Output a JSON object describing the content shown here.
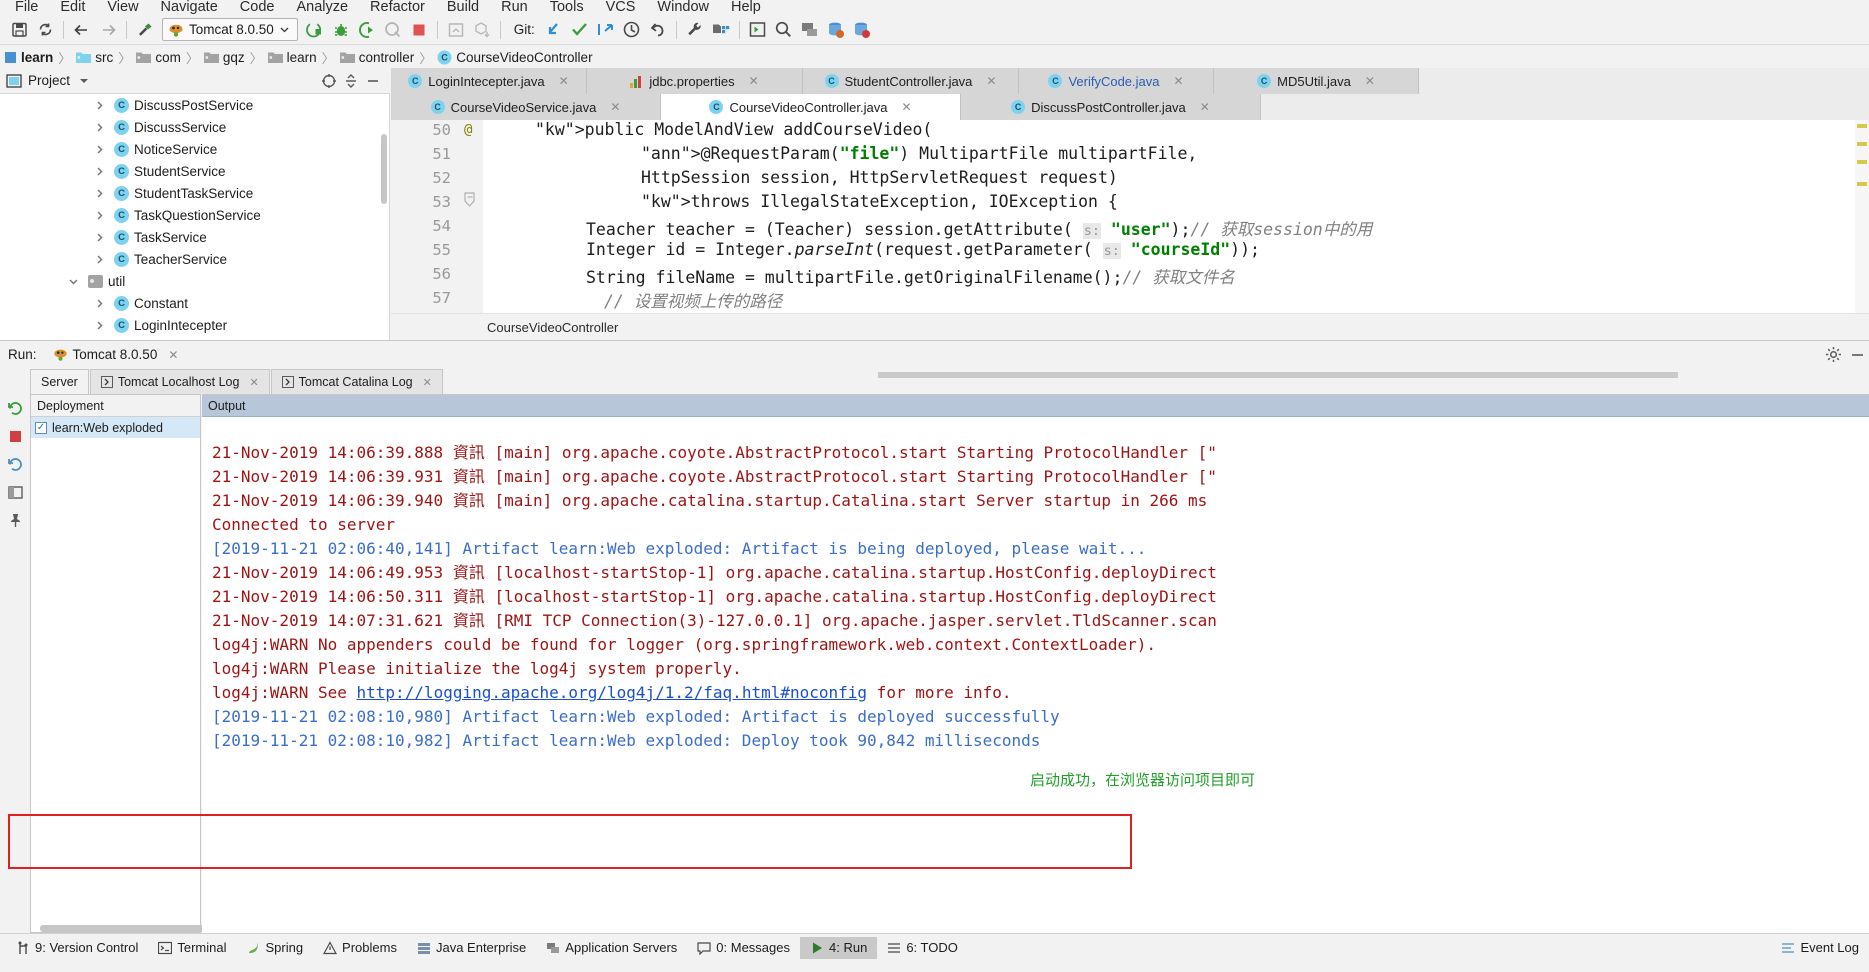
{
  "menubar": {
    "items": [
      "File",
      "Edit",
      "View",
      "Navigate",
      "Code",
      "Analyze",
      "Refactor",
      "Build",
      "Run",
      "Tools",
      "VCS",
      "Window",
      "Help"
    ]
  },
  "toolbar": {
    "save_icon": "save-icon",
    "sync_icon": "sync-icon",
    "back_icon": "back-arrow-icon",
    "forward_icon": "forward-arrow-icon",
    "build_icon": "hammer-icon",
    "run_config_label": "Tomcat 8.0.50",
    "run_config_icon": "tomcat-icon",
    "run_icon": "run-icon",
    "debug_icon": "debug-bug-icon",
    "run_coverage_icon": "run-coverage-icon",
    "profile_icon": "profile-icon",
    "stop_icon": "stop-icon",
    "update_app_icon": "update-app-icon",
    "package_icon": "package-down-icon",
    "git_label": "Git:",
    "git_update_icon": "git-update-icon",
    "git_commit_icon": "git-commit-check-icon",
    "git_push_icon": "git-push-icon",
    "history_icon": "clock-history-icon",
    "rollback_icon": "undo-rollback-icon",
    "settings_icon": "wrench-settings-icon",
    "project-structure_icon": "project-structure-icon",
    "run_dashboard_icon": "run-dashboard-icon",
    "search_everywhere_icon": "search-icon",
    "app_servers_icon": "app-servers-icon",
    "db_icon1": "database-icon",
    "db_icon2": "database-alt-icon"
  },
  "breadcrumb": {
    "items": [
      {
        "label": "learn",
        "icon": "module-icon",
        "bold": true
      },
      {
        "label": "src",
        "icon": "source-folder-icon",
        "bold": false
      },
      {
        "label": "com",
        "icon": "folder-icon",
        "bold": false
      },
      {
        "label": "gqz",
        "icon": "folder-icon",
        "bold": false
      },
      {
        "label": "learn",
        "icon": "folder-icon",
        "bold": false
      },
      {
        "label": "controller",
        "icon": "folder-icon",
        "bold": false
      },
      {
        "label": "CourseVideoController",
        "icon": "class-icon",
        "bold": false
      }
    ],
    "separator": "〉"
  },
  "project_panel": {
    "title": "Project",
    "dropdown_icon": "chevron-down-icon",
    "panel_icon": "project-view-icon",
    "locate_icon": "locate-target-icon",
    "collapse_icon": "collapse-all-icon",
    "close_icon": "hide-icon",
    "tree": [
      {
        "label": "DiscussPostService",
        "type": "class",
        "indent": 3,
        "expandable": true
      },
      {
        "label": "DiscussService",
        "type": "class",
        "indent": 3,
        "expandable": true
      },
      {
        "label": "NoticeService",
        "type": "class",
        "indent": 3,
        "expandable": true
      },
      {
        "label": "StudentService",
        "type": "class",
        "indent": 3,
        "expandable": true
      },
      {
        "label": "StudentTaskService",
        "type": "class",
        "indent": 3,
        "expandable": true
      },
      {
        "label": "TaskQuestionService",
        "type": "class",
        "indent": 3,
        "expandable": true
      },
      {
        "label": "TaskService",
        "type": "class",
        "indent": 3,
        "expandable": true
      },
      {
        "label": "TeacherService",
        "type": "class",
        "indent": 3,
        "expandable": true
      },
      {
        "label": "util",
        "type": "folder",
        "indent": 2,
        "expandable": true,
        "expanded": true
      },
      {
        "label": "Constant",
        "type": "class",
        "indent": 3,
        "expandable": true
      },
      {
        "label": "LoginIntecepter",
        "type": "class",
        "indent": 3,
        "expandable": true
      }
    ]
  },
  "editor": {
    "tabs_row1": [
      {
        "label": "LoginIntecepter.java",
        "icon": "class-icon",
        "active": false,
        "blue": false
      },
      {
        "label": "jdbc.properties",
        "icon": "properties-icon",
        "active": false,
        "blue": false
      },
      {
        "label": "StudentController.java",
        "icon": "class-icon",
        "active": false,
        "blue": false
      },
      {
        "label": "VerifyCode.java",
        "icon": "class-icon",
        "active": false,
        "blue": true
      },
      {
        "label": "MD5Util.java",
        "icon": "class-icon",
        "active": false,
        "blue": false
      }
    ],
    "tabs_row2": [
      {
        "label": "CourseVideoService.java",
        "icon": "class-icon",
        "active": false,
        "blue": false
      },
      {
        "label": "CourseVideoController.java",
        "icon": "class-icon",
        "active": true,
        "blue": false
      },
      {
        "label": "DiscussPostController.java",
        "icon": "class-icon",
        "active": false,
        "blue": false
      }
    ],
    "close_icon": "close-icon",
    "line_numbers": [
      "50",
      "51",
      "52",
      "53",
      "54",
      "55",
      "56",
      "57"
    ],
    "breadcrumb_status": "CourseVideoController",
    "code_lines": [
      "public ModelAndView addCourseVideo(",
      "@RequestParam(\"file\") MultipartFile multipartFile,",
      "HttpSession session, HttpServletRequest request)",
      "throws IllegalStateException, IOException {",
      "Teacher teacher = (Teacher) session.getAttribute( s: \"user\");// 获取session中的用",
      "Integer id = Integer.parseInt(request.getParameter( s: \"courseId\"));",
      "String fileName = multipartFile.getOriginalFilename();// 获取文件名",
      "// 设置视频上传的路径"
    ]
  },
  "run_window": {
    "title": "Run:",
    "config_label": "Tomcat 8.0.50",
    "config_icon": "tomcat-icon",
    "close_icon": "close-icon",
    "settings_icon": "gear-icon",
    "minimize_icon": "minimize-icon",
    "subtabs": [
      {
        "label": "Server",
        "icon": "",
        "active": true,
        "closable": false
      },
      {
        "label": "Tomcat Localhost Log",
        "icon": "log-icon",
        "active": false,
        "closable": true
      },
      {
        "label": "Tomcat Catalina Log",
        "icon": "log-icon",
        "active": false,
        "closable": true
      }
    ],
    "deployment_header": "Deployment",
    "deployment_items": [
      {
        "label": "learn:Web exploded",
        "checked": true
      }
    ],
    "output_header": "Output",
    "sidebar_icons": [
      "rerun-icon",
      "stop-icon",
      "rerun-failed-icon",
      "layout-icon",
      "pin-icon"
    ],
    "console_toolbar_icons": [
      "scroll-up-icon",
      "scroll-down-icon",
      "soft-wrap-icon",
      "scroll-to-end-icon",
      "print-icon",
      "trash-icon"
    ],
    "console_lines": [
      {
        "text": "21-Nov-2019 14:06:39.888 資訊 [main] org.apache.coyote.AbstractProtocol.start Starting ProtocolHandler [\"",
        "color": "red"
      },
      {
        "text": "21-Nov-2019 14:06:39.931 資訊 [main] org.apache.coyote.AbstractProtocol.start Starting ProtocolHandler [\"",
        "color": "red"
      },
      {
        "text": "21-Nov-2019 14:06:39.940 資訊 [main] org.apache.catalina.startup.Catalina.start Server startup in 266 ms",
        "color": "red"
      },
      {
        "text": "Connected to server",
        "color": "red"
      },
      {
        "text": "[2019-11-21 02:06:40,141] Artifact learn:Web exploded: Artifact is being deployed, please wait...",
        "color": "blue"
      },
      {
        "text": "21-Nov-2019 14:06:49.953 資訊 [localhost-startStop-1] org.apache.catalina.startup.HostConfig.deployDirect",
        "color": "red"
      },
      {
        "text": "21-Nov-2019 14:06:50.311 資訊 [localhost-startStop-1] org.apache.catalina.startup.HostConfig.deployDirect",
        "color": "red"
      },
      {
        "text": "21-Nov-2019 14:07:31.621 資訊 [RMI TCP Connection(3)-127.0.0.1] org.apache.jasper.servlet.TldScanner.scan",
        "color": "red"
      },
      {
        "text": "log4j:WARN No appenders could be found for logger (org.springframework.web.context.ContextLoader).",
        "color": "red"
      },
      {
        "text": "log4j:WARN Please initialize the log4j system properly.",
        "color": "red"
      },
      {
        "text": "log4j:WARN See ",
        "link": "http://logging.apache.org/log4j/1.2/faq.html#noconfig",
        "suffix": " for more info.",
        "color": "red"
      },
      {
        "text": "[2019-11-21 02:08:10,980] Artifact learn:Web exploded: Artifact is deployed successfully",
        "color": "blue"
      },
      {
        "text": "[2019-11-21 02:08:10,982] Artifact learn:Web exploded: Deploy took 90,842 milliseconds",
        "color": "blue"
      }
    ],
    "annotation": "启动成功，在浏览器访问项目即可"
  },
  "statusbar": {
    "items": [
      {
        "label": "9: Version Control",
        "icon": "version-control-icon",
        "active": false
      },
      {
        "label": "Terminal",
        "icon": "terminal-icon",
        "active": false
      },
      {
        "label": "Spring",
        "icon": "spring-leaf-icon",
        "active": false
      },
      {
        "label": "Problems",
        "icon": "warning-icon",
        "active": false
      },
      {
        "label": "Java Enterprise",
        "icon": "java-enterprise-icon",
        "active": false
      },
      {
        "label": "Application Servers",
        "icon": "app-servers-icon",
        "active": false
      },
      {
        "label": "0: Messages",
        "icon": "messages-icon",
        "active": false
      },
      {
        "label": "4: Run",
        "icon": "run-icon",
        "active": true
      },
      {
        "label": "6: TODO",
        "icon": "todo-icon",
        "active": false
      }
    ],
    "event_log": "Event Log",
    "event_log_icon": "event-log-icon"
  },
  "colors": {
    "accent_blue": "#2a5db0",
    "console_red": "#9e1313",
    "console_blue": "#3a6ec8",
    "annotation_green": "#22a02a",
    "highlight_box": "#e02020",
    "class_icon": "#7dd3ef"
  }
}
